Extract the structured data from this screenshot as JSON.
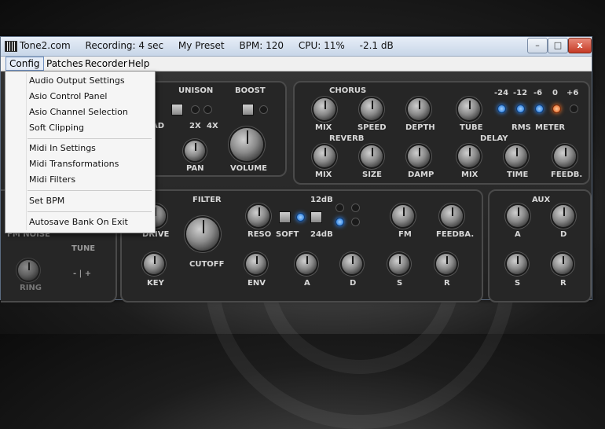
{
  "window": {
    "app_name": "Tone2.com",
    "recording": "Recording: 4 sec",
    "preset": "My Preset",
    "bpm": "BPM: 120",
    "cpu": "CPU: 11%",
    "level": "-2.1 dB",
    "close_label": "x",
    "minimize_label": "–",
    "maximize_label": "□"
  },
  "menubar": {
    "items": [
      "Config",
      "Patches",
      "Recorder",
      "Help"
    ]
  },
  "config_menu": {
    "items": [
      "Audio Output Settings",
      "Asio Control Panel",
      "Asio Channel Selection",
      "Soft Clipping",
      "Midi In Settings",
      "Midi Transformations",
      "Midi Filters",
      "Set BPM",
      "Autosave Bank On Exit"
    ]
  },
  "synth": {
    "unison": {
      "title": "UNISON",
      "opt_2x": "2X",
      "opt_4x": "4X",
      "pan": "PAN",
      "head_partial": "AD"
    },
    "boost": {
      "title": "BOOST",
      "volume": "VOLUME"
    },
    "chorus": {
      "title": "CHORUS",
      "mix": "MIX",
      "speed": "SPEED",
      "depth": "DEPTH",
      "tube": "TUBE"
    },
    "meter": {
      "ticks": [
        "-24",
        "-12",
        "-6",
        "0",
        "+6"
      ],
      "rms": "RMS",
      "meter": "METER"
    },
    "reverb": {
      "title": "REVERB",
      "mix": "MIX",
      "size": "SIZE",
      "damp": "DAMP"
    },
    "delay": {
      "title": "DELAY",
      "mix": "MIX",
      "time": "TIME",
      "feedb": "FEEDB."
    },
    "filter": {
      "title": "FILTER",
      "drive": "DRIVE",
      "cutoff": "CUTOFF",
      "key": "KEY",
      "reso": "RESO",
      "soft": "SOFT",
      "db12": "12dB",
      "db24": "24dB",
      "fm": "FM",
      "feedba": "FEEDBA.",
      "env": "ENV",
      "a": "A",
      "d": "D",
      "s": "S",
      "r": "R"
    },
    "osc": {
      "fm_noise": "FM NOISE",
      "tune": "TUNE",
      "ring": "RING",
      "plus_minus": "- | +"
    },
    "aux": {
      "title": "AUX",
      "a": "A",
      "d": "D",
      "s": "S",
      "r": "R"
    }
  }
}
